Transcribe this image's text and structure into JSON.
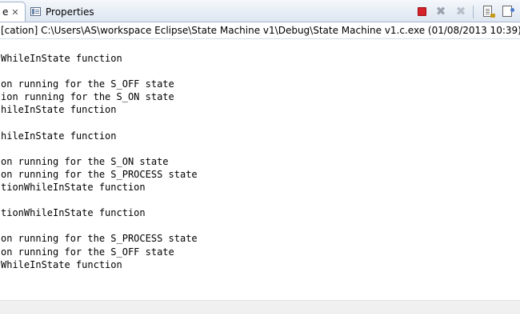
{
  "tabs": {
    "console_label": "e",
    "console_close": "✕",
    "properties_label": "Properties"
  },
  "toolbar": {
    "icons": [
      "stop-icon",
      "remove-launch-icon",
      "remove-all-launches-icon",
      "scroll-lock-icon",
      "pin-console-icon"
    ]
  },
  "process_info": "[cation] C:\\Users\\AS\\workspace Eclipse\\State Machine v1\\Debug\\State Machine v1.c.exe (01/08/2013 10:39)",
  "console": {
    "lines": [
      "WhileInState function",
      "",
      "on running for the S_OFF state",
      "ion running for the S_ON state",
      "hileInState function",
      "",
      "hileInState function",
      "",
      "on running for the S_ON state",
      "on running for the S_PROCESS state",
      "tionWhileInState function",
      "",
      "tionWhileInState function",
      "",
      "on running for the S_PROCESS state",
      "on running for the S_OFF state",
      "WhileInState function"
    ]
  },
  "colors": {
    "stop": "#d6212b",
    "tab_border": "#9db0c8"
  }
}
